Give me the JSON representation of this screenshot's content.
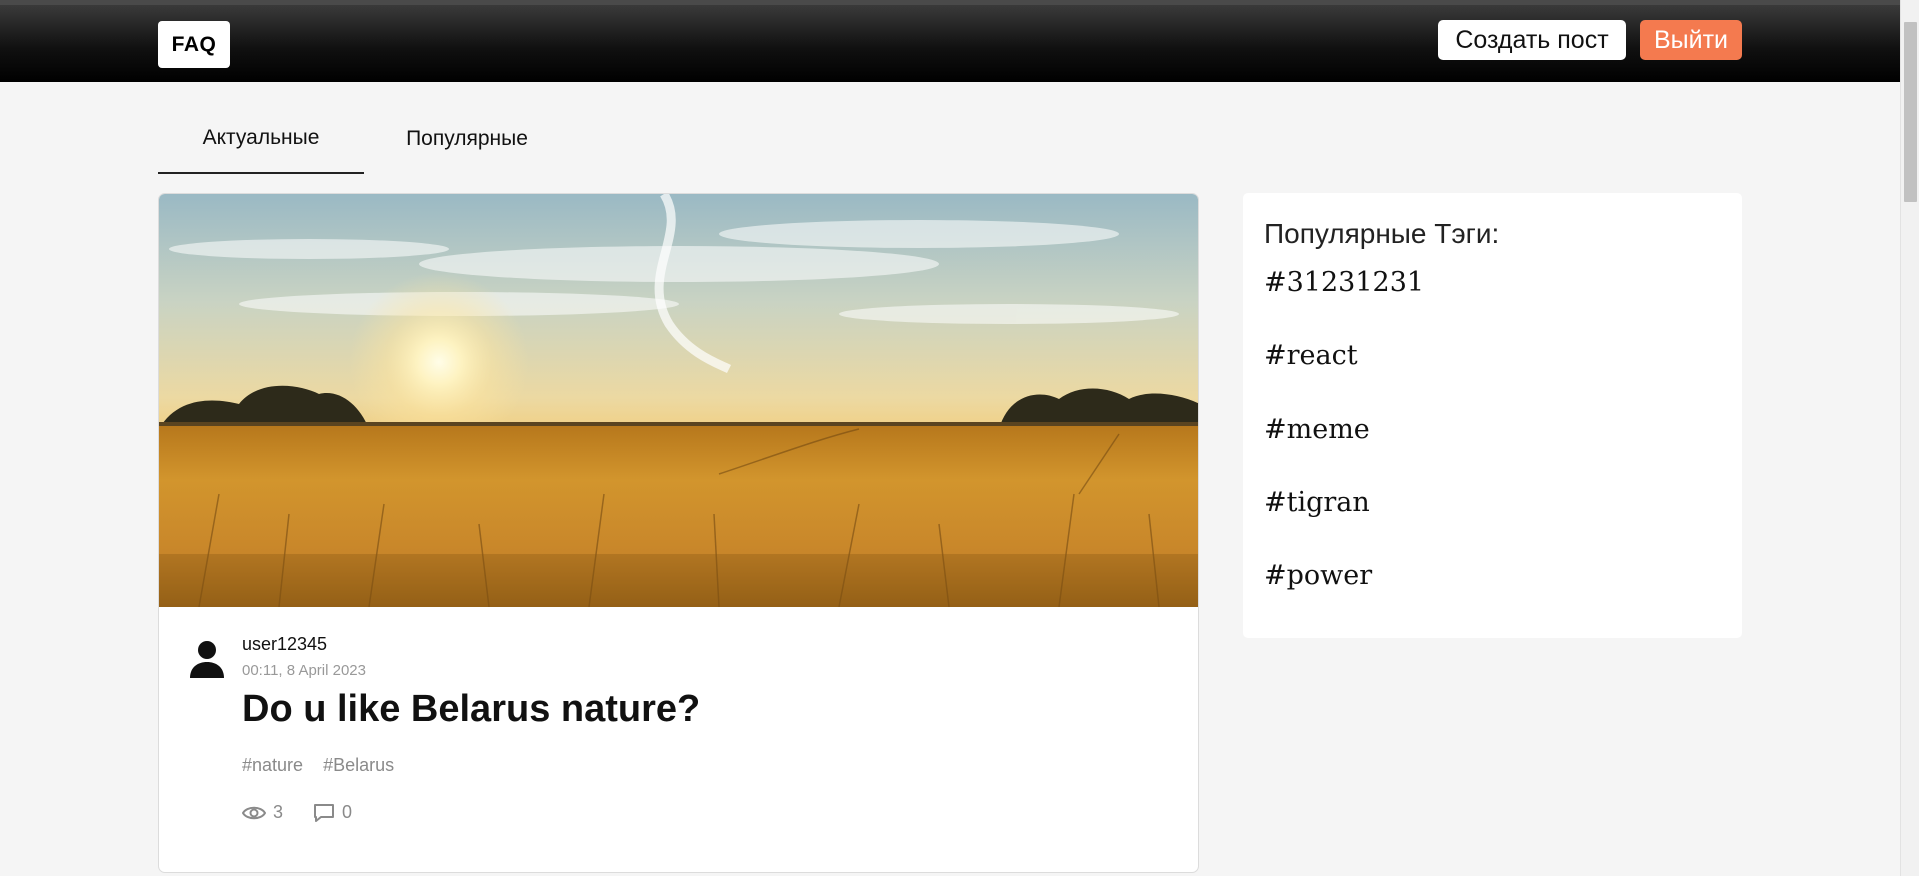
{
  "header": {
    "logo": "FAQ",
    "create_post_label": "Создать пост",
    "logout_label": "Выйти"
  },
  "tabs": [
    {
      "label": "Актуальные",
      "active": true
    },
    {
      "label": "Популярные",
      "active": false
    }
  ],
  "post": {
    "image_description": "wheat field at sunset",
    "avatar_icon": "user-icon",
    "username": "user12345",
    "date": "00:11, 8 April 2023",
    "title": "Do u like Belarus nature?",
    "tags": [
      "#nature",
      "#Belarus"
    ],
    "views": "3",
    "comments": "0",
    "views_icon": "eye-icon",
    "comments_icon": "comment-icon"
  },
  "sidebar": {
    "title": "Популярные Тэги:",
    "tags": [
      "#31231231",
      "#react",
      "#meme",
      "#tigran",
      "#power"
    ]
  },
  "colors": {
    "header_bg": "#000000",
    "logout_accent": "#f47a4f",
    "page_bg": "#f5f5f5",
    "muted_text": "#8a8a8a"
  }
}
